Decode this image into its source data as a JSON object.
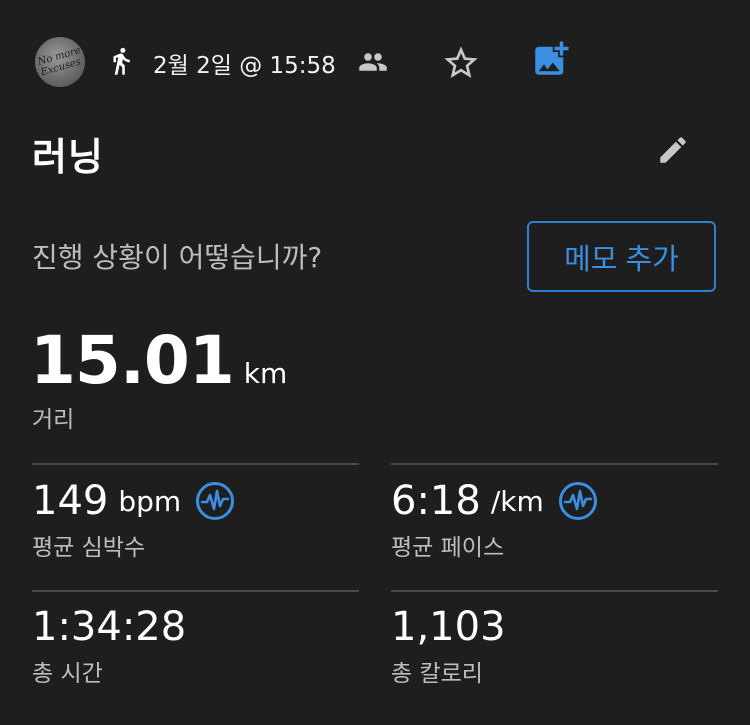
{
  "header": {
    "avatar_text_line1": "No more",
    "avatar_text_line2": "Excuses",
    "date_time": "2월 2일 @ 15:58"
  },
  "activity": {
    "title": "러닝"
  },
  "prompt": {
    "question": "진행 상황이 어떻습니까?",
    "memo_button": "메모 추가"
  },
  "distance": {
    "value": "15.01",
    "unit": "km",
    "label": "거리"
  },
  "stats": {
    "heart_rate": {
      "value": "149",
      "unit": "bpm",
      "label": "평균 심박수"
    },
    "pace": {
      "value": "6:18",
      "unit": "/km",
      "label": "평균 페이스"
    },
    "time": {
      "value": "1:34:28",
      "label": "총 시간"
    },
    "calories": {
      "value": "1,103",
      "label": "총 칼로리"
    }
  },
  "colors": {
    "background": "#1e1e1e",
    "accent": "#2f80d1",
    "icon_gray": "#c8c8c8",
    "label_gray": "#bdbdbd"
  },
  "icons": [
    "running-icon",
    "people-icon",
    "star-icon",
    "add-photo-icon",
    "pencil-icon",
    "heart-rate-graph-icon"
  ]
}
